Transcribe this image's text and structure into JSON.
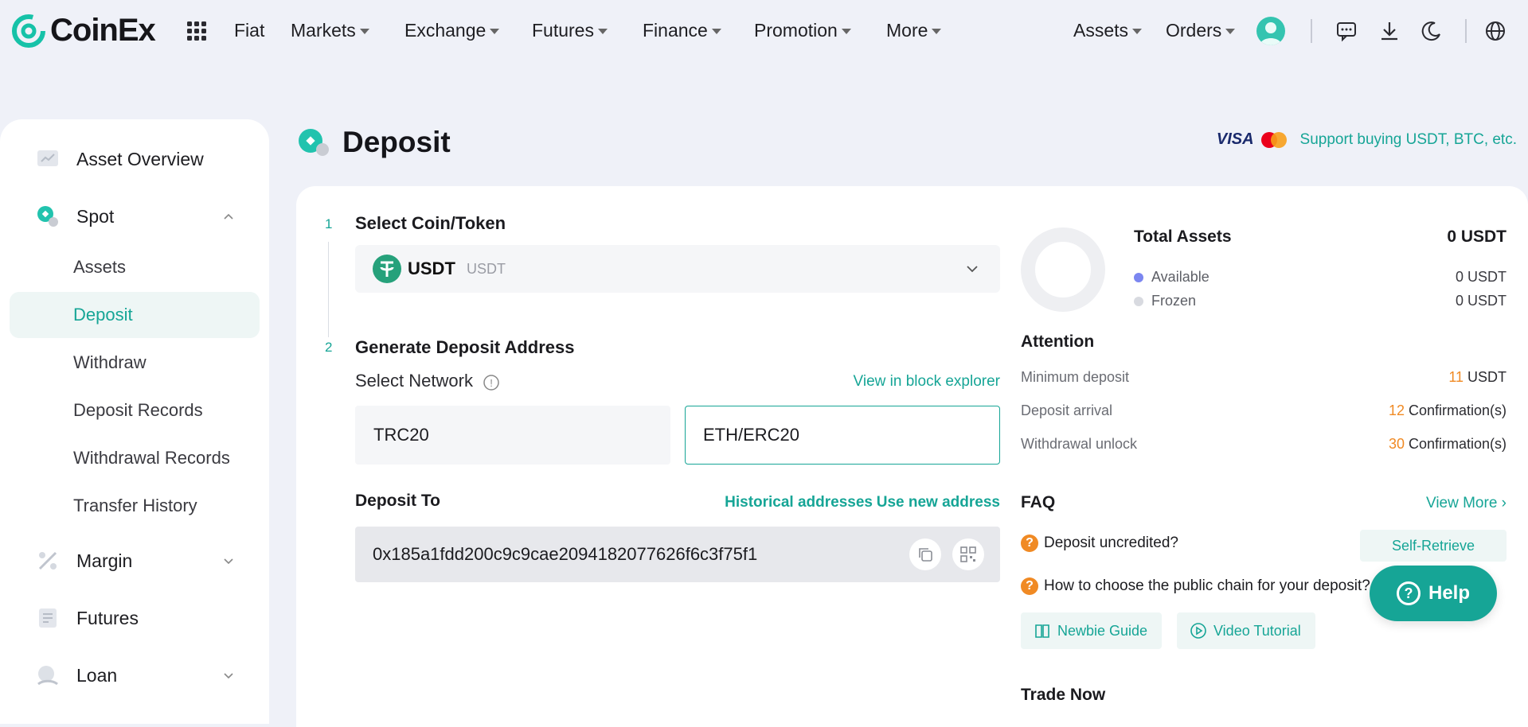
{
  "brand": {
    "name": "CoinEx",
    "accent": "#16a596"
  },
  "nav": {
    "fiat": "Fiat",
    "markets": "Markets",
    "exchange": "Exchange",
    "futures": "Futures",
    "finance": "Finance",
    "promotion": "Promotion",
    "more": "More",
    "assets": "Assets",
    "orders": "Orders"
  },
  "sidebar": {
    "asset_overview": "Asset Overview",
    "spot": "Spot",
    "spot_items": [
      "Assets",
      "Deposit",
      "Withdraw",
      "Deposit Records",
      "Withdrawal Records",
      "Transfer History"
    ],
    "margin": "Margin",
    "futures": "Futures",
    "loan": "Loan"
  },
  "page": {
    "title": "Deposit",
    "payment_brand": "VISA",
    "promo": "Support buying USDT, BTC, etc."
  },
  "deposit": {
    "step1_num": "1",
    "step1_title": "Select Coin/Token",
    "coin_name": "USDT",
    "coin_full": "USDT",
    "step2_num": "2",
    "step2_title": "Generate Deposit Address",
    "select_network": "Select Network",
    "info_glyph": "!",
    "view_explorer": "View in block explorer",
    "networks": [
      "TRC20",
      "ETH/ERC20"
    ],
    "selected_network": "ETH/ERC20",
    "deposit_to": "Deposit To",
    "historical": "Historical addresses",
    "new_address": "Use new address",
    "address": "0x185a1fdd200c9c9cae2094182077626f6c3f75f1"
  },
  "assets": {
    "total_label": "Total Assets",
    "total_value": "0 USDT",
    "available_label": "Available",
    "available_value": "0 USDT",
    "frozen_label": "Frozen",
    "frozen_value": "0 USDT",
    "available_color": "#7b86f0",
    "frozen_color": "#d8dae0"
  },
  "attention": {
    "title": "Attention",
    "min_label": "Minimum deposit",
    "min_num": "11",
    "min_unit": " USDT",
    "arrival_label": "Deposit arrival",
    "arrival_num": "12",
    "arrival_unit": " Confirmation(s)",
    "unlock_label": "Withdrawal unlock",
    "unlock_num": "30",
    "unlock_unit": " Confirmation(s)"
  },
  "faq": {
    "title": "FAQ",
    "view_more": "View More ›",
    "q_mark": "?",
    "q1": "Deposit uncredited?",
    "self_retrieve": "Self-Retrieve",
    "q2": "How to choose the public chain for your deposit?",
    "newbie": "Newbie Guide",
    "video": "Video Tutorial",
    "trade_now": "Trade Now"
  },
  "help": {
    "label": "Help",
    "glyph": "?"
  }
}
